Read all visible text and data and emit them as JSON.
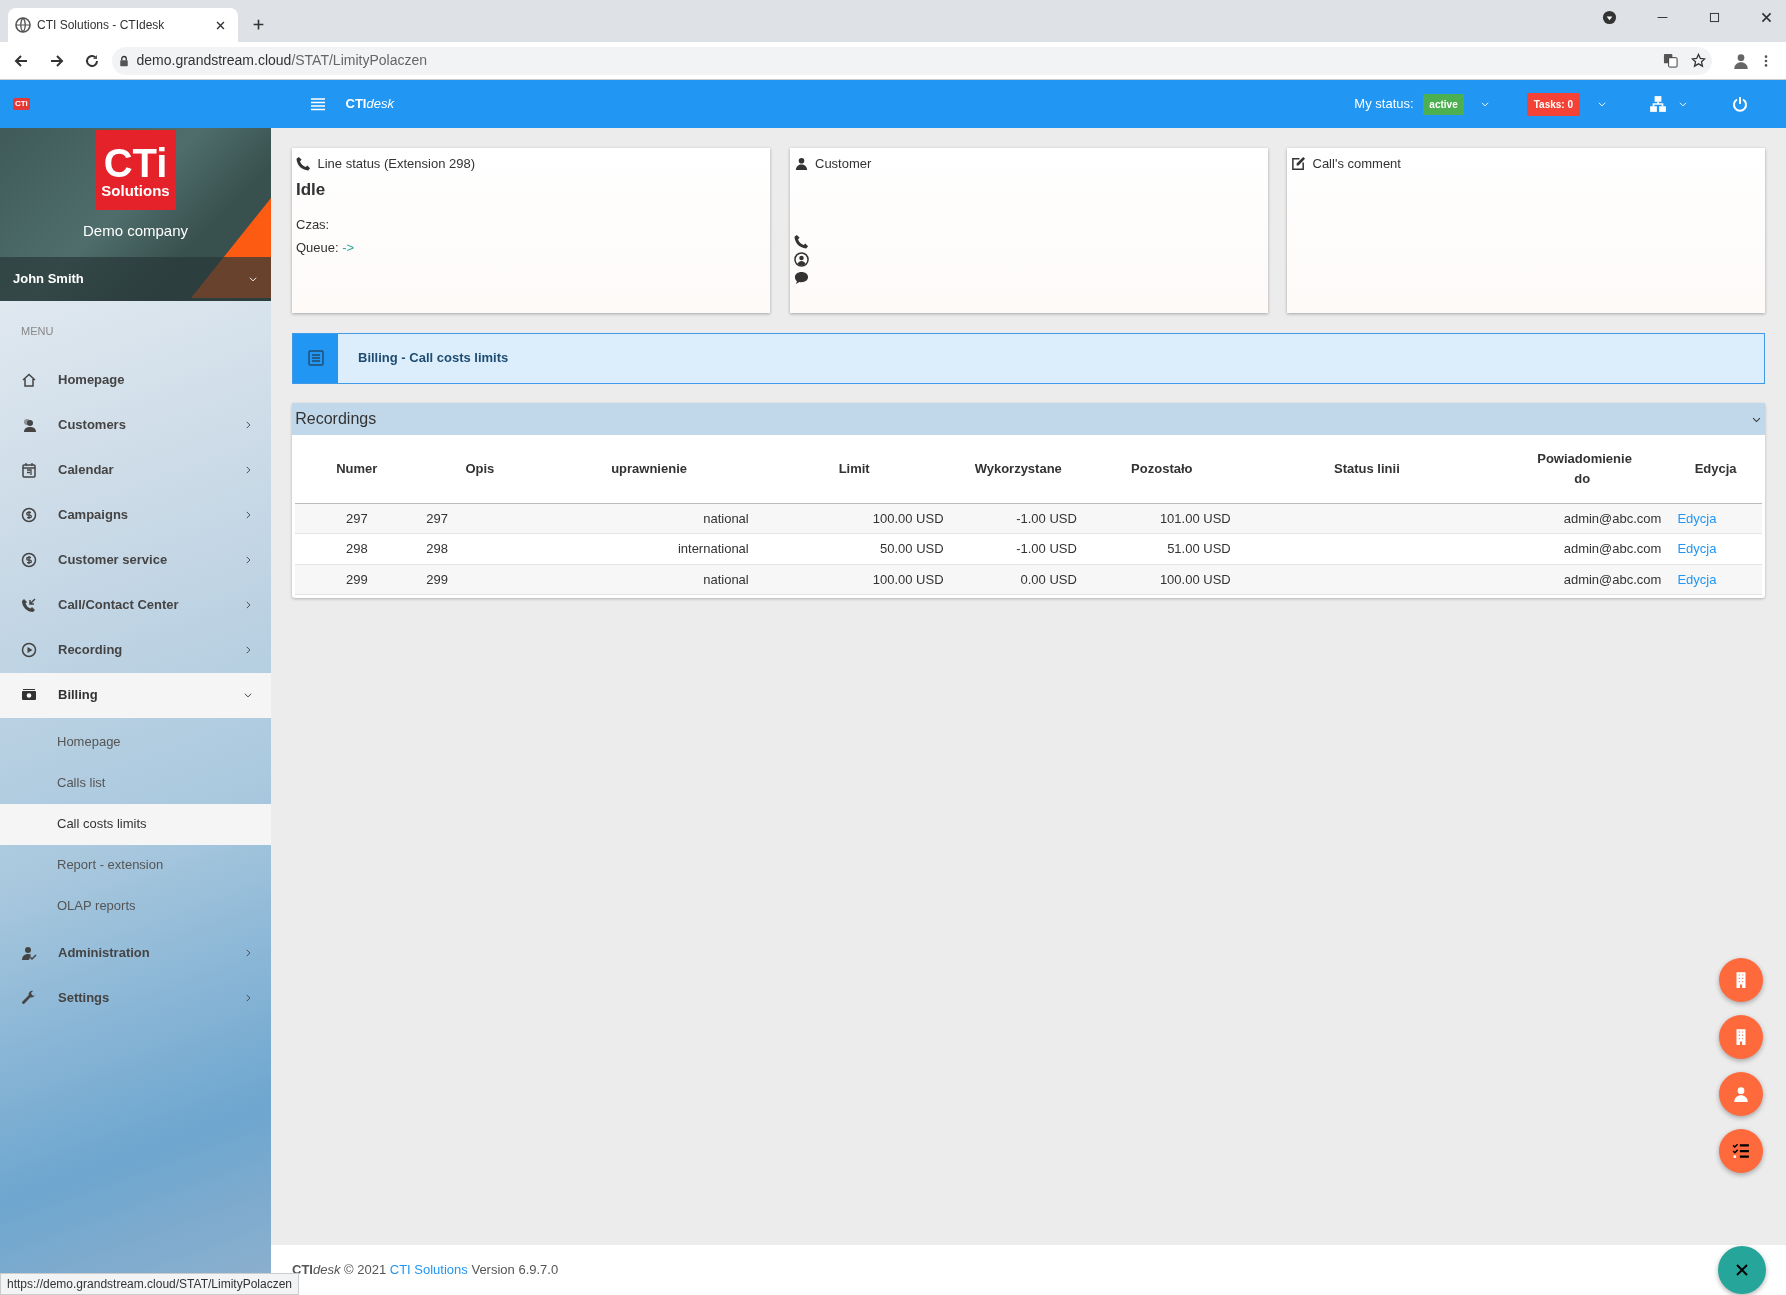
{
  "browser": {
    "tab_title": "CTI Solutions - CTIdesk",
    "url_host": "demo.grandstream.cloud",
    "url_path": "/STAT/LimityPolaczen",
    "status_url": "https://demo.grandstream.cloud/STAT/LimityPolaczen"
  },
  "topbar": {
    "logo": "CTi",
    "brand_bold": "CTI",
    "brand_italic": "desk",
    "status_label": "My status:",
    "status": "active",
    "tasks": "Tasks: 0"
  },
  "sidebar": {
    "logo_main": "CTi",
    "logo_sub": "Solutions",
    "company": "Demo company",
    "user": "John Smith",
    "menu_label": "MENU",
    "items": [
      {
        "label": "Homepage",
        "selected": false
      },
      {
        "label": "Customers",
        "selected": false,
        "expanded": false
      },
      {
        "label": "Calendar",
        "selected": false,
        "expanded": false
      },
      {
        "label": "Campaigns",
        "selected": false,
        "expanded": false
      },
      {
        "label": "Customer service",
        "selected": false,
        "expanded": false
      },
      {
        "label": "Call/Contact Center",
        "selected": false,
        "expanded": false
      },
      {
        "label": "Recording",
        "selected": false,
        "expanded": false
      },
      {
        "label": "Billing",
        "selected": true,
        "expanded": true,
        "children": [
          {
            "label": "Homepage",
            "selected": false
          },
          {
            "label": "Calls list",
            "selected": false
          },
          {
            "label": "Call costs limits",
            "selected": true
          },
          {
            "label": "Report - extension",
            "selected": false
          },
          {
            "label": "OLAP reports",
            "selected": false
          }
        ]
      },
      {
        "label": "Administration",
        "selected": false,
        "expanded": false
      },
      {
        "label": "Settings",
        "selected": false,
        "expanded": false
      }
    ]
  },
  "line_status": {
    "title": "Line status (Extension 298)",
    "state": "Idle",
    "fields": [
      {
        "label": "Czas:"
      },
      {
        "label": "Queue:",
        "value": "->"
      }
    ]
  },
  "customer": {
    "title": "Customer"
  },
  "comment": {
    "title": "Call's comment"
  },
  "banner": {
    "text": "**Billing** - Call costs limits"
  },
  "panel": {
    "title": "Recordings",
    "expanded": true,
    "columns": [
      "Numer",
      "Opis",
      "uprawnienie",
      "Limit",
      "Wykorzystane",
      "Pozostało",
      "Status linii",
      "Powiadomienie do",
      "Edycja"
    ],
    "rows": [
      {
        "numer": "297",
        "opis": "297",
        "uprawnienie": "national",
        "limit": "100.00 USD",
        "wykorzystane": "-1.00 USD",
        "pozostalo": "101.00 USD",
        "powiadomienie": "admin@abc.com",
        "edycja": "Edycja"
      },
      {
        "numer": "298",
        "opis": "298",
        "uprawnienie": "international",
        "limit": "50.00 USD",
        "wykorzystane": "-1.00 USD",
        "pozostalo": "51.00 USD",
        "powiadomienie": "admin@abc.com",
        "edycja": "Edycja"
      },
      {
        "numer": "299",
        "opis": "299",
        "uprawnienie": "national",
        "limit": "100.00 USD",
        "wykorzystane": "0.00 USD",
        "pozostalo": "100.00 USD",
        "powiadomienie": "admin@abc.com",
        "edycja": "Edycja"
      }
    ]
  },
  "footer": {
    "brand_bold": "CTI",
    "brand_italic": "desk",
    "copyright": "© 2021",
    "link": "CTI Solutions",
    "version": "Version 6.9.7.0"
  }
}
